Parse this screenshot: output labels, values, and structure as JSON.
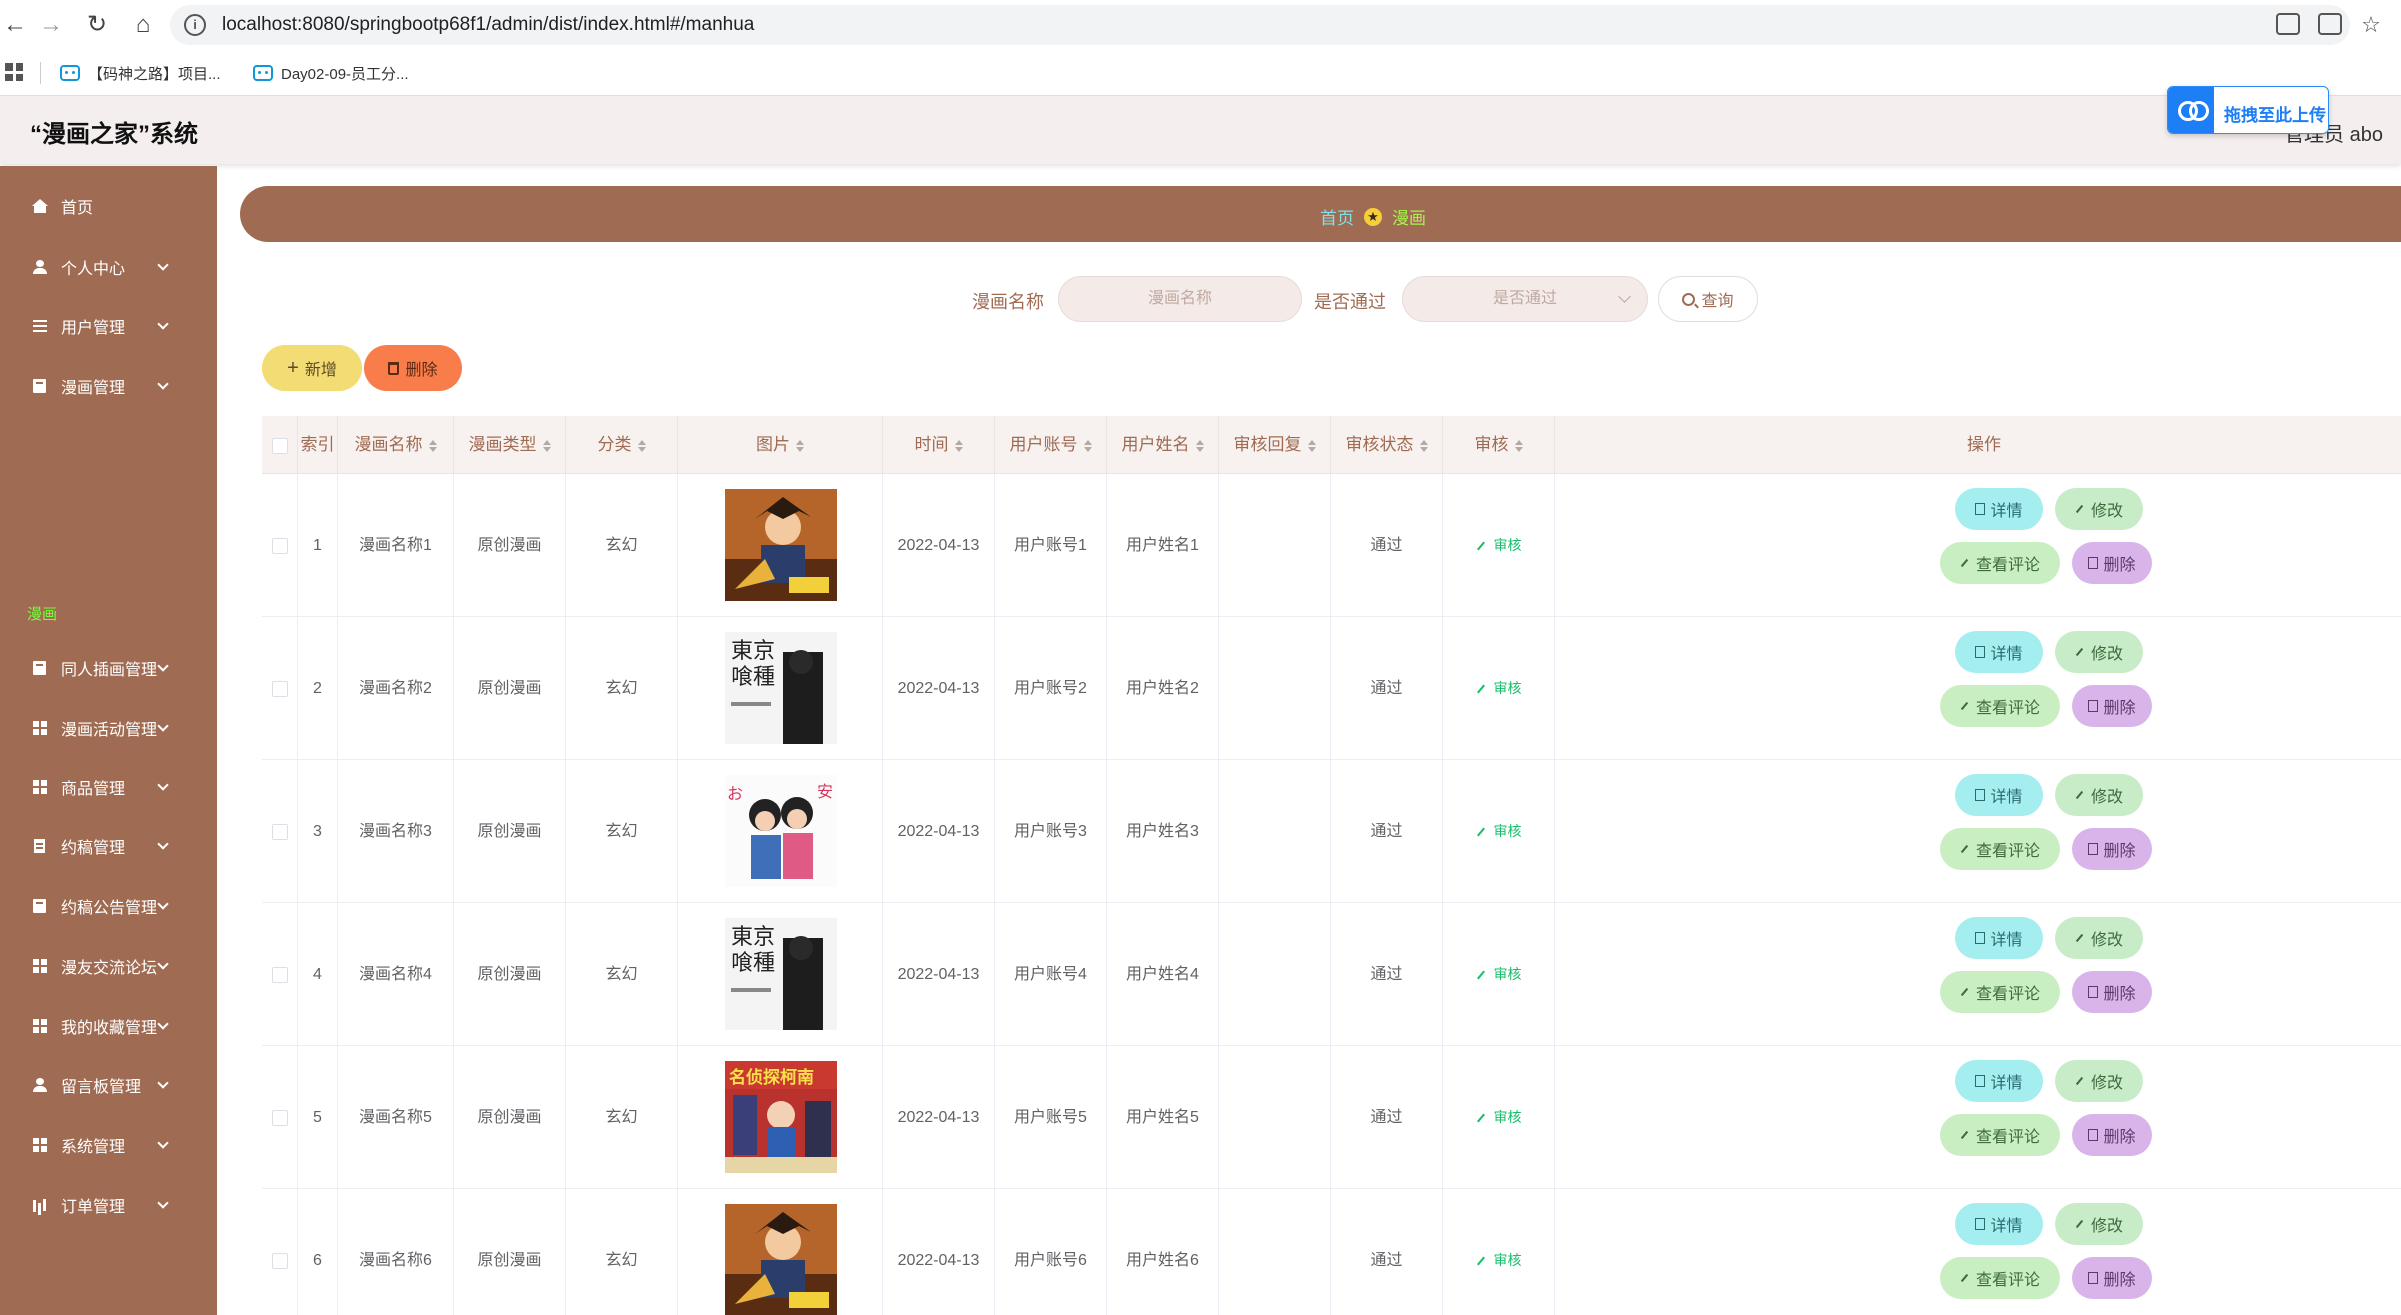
{
  "browser": {
    "url": "localhost:8080/springbootp68f1/admin/dist/index.html#/manhua",
    "bookmarks": [
      "【码神之路】项目...",
      "Day02-09-员工分..."
    ]
  },
  "header": {
    "title": "“漫画之家”系统",
    "user": "管理员 abo",
    "upload_label": "拖拽至此上传"
  },
  "sidebar": {
    "items": [
      {
        "label": "首页",
        "icon": "home-icon",
        "expandable": false
      },
      {
        "label": "个人中心",
        "icon": "user-icon",
        "expandable": true
      },
      {
        "label": "用户管理",
        "icon": "menu-icon",
        "expandable": true
      },
      {
        "label": "漫画管理",
        "icon": "book-icon",
        "expandable": true
      },
      {
        "label": "同人插画管理",
        "icon": "book-icon",
        "expandable": true
      },
      {
        "label": "漫画活动管理",
        "icon": "grid-icon",
        "expandable": true
      },
      {
        "label": "商品管理",
        "icon": "grid-icon",
        "expandable": true
      },
      {
        "label": "约稿管理",
        "icon": "doc-icon",
        "expandable": true
      },
      {
        "label": "约稿公告管理",
        "icon": "book-icon",
        "expandable": true
      },
      {
        "label": "漫友交流论坛",
        "icon": "grid-icon",
        "expandable": true
      },
      {
        "label": "我的收藏管理",
        "icon": "grid-icon",
        "expandable": true
      },
      {
        "label": "留言板管理",
        "icon": "user-icon",
        "expandable": true
      },
      {
        "label": "系统管理",
        "icon": "grid-icon",
        "expandable": true
      },
      {
        "label": "订单管理",
        "icon": "chart-icon",
        "expandable": true
      }
    ],
    "active_sub": "漫画"
  },
  "breadcrumb": {
    "home": "首页",
    "current": "漫画"
  },
  "search": {
    "name_label": "漫画名称",
    "name_placeholder": "漫画名称",
    "pass_label": "是否通过",
    "pass_placeholder": "是否通过",
    "query_label": "查询"
  },
  "actions": {
    "add": "新增",
    "delete": "删除"
  },
  "table": {
    "headers": [
      "索引",
      "漫画名称",
      "漫画类型",
      "分类",
      "图片",
      "时间",
      "用户账号",
      "用户姓名",
      "审核回复",
      "审核状态",
      "审核",
      "操作"
    ],
    "rows": [
      {
        "index": "1",
        "name": "漫画名称1",
        "type": "原创漫画",
        "category": "玄幻",
        "cover": "cover-a",
        "time": "2022-04-13",
        "account": "用户账号1",
        "username": "用户姓名1",
        "reply": "",
        "status": "通过"
      },
      {
        "index": "2",
        "name": "漫画名称2",
        "type": "原创漫画",
        "category": "玄幻",
        "cover": "cover-b",
        "time": "2022-04-13",
        "account": "用户账号2",
        "username": "用户姓名2",
        "reply": "",
        "status": "通过"
      },
      {
        "index": "3",
        "name": "漫画名称3",
        "type": "原创漫画",
        "category": "玄幻",
        "cover": "cover-c",
        "time": "2022-04-13",
        "account": "用户账号3",
        "username": "用户姓名3",
        "reply": "",
        "status": "通过"
      },
      {
        "index": "4",
        "name": "漫画名称4",
        "type": "原创漫画",
        "category": "玄幻",
        "cover": "cover-b",
        "time": "2022-04-13",
        "account": "用户账号4",
        "username": "用户姓名4",
        "reply": "",
        "status": "通过"
      },
      {
        "index": "5",
        "name": "漫画名称5",
        "type": "原创漫画",
        "category": "玄幻",
        "cover": "cover-d",
        "time": "2022-04-13",
        "account": "用户账号5",
        "username": "用户姓名5",
        "reply": "",
        "status": "通过"
      },
      {
        "index": "6",
        "name": "漫画名称6",
        "type": "原创漫画",
        "category": "玄幻",
        "cover": "cover-a",
        "time": "2022-04-13",
        "account": "用户账号6",
        "username": "用户姓名6",
        "reply": "",
        "status": "通过"
      }
    ],
    "audit_label": "审核",
    "op_labels": {
      "detail": "详情",
      "edit": "修改",
      "comment": "查看评论",
      "delete": "删除"
    }
  },
  "colors": {
    "sidebar_bg": "#a06b53",
    "accent_text": "#a06b53",
    "active_sub": "#73ff3a",
    "breadcrumb_home": "#7ce3e8",
    "breadcrumb_current": "#a6f34d",
    "add_btn": "#f2dc73",
    "delete_btn": "#f87d4a",
    "detail_btn": "#a4eef0",
    "edit_btn": "#c7ecc7",
    "comment_btn": "#c9eec2",
    "row_delete_btn": "#d9b4ea",
    "audit_link": "#19be6b"
  }
}
